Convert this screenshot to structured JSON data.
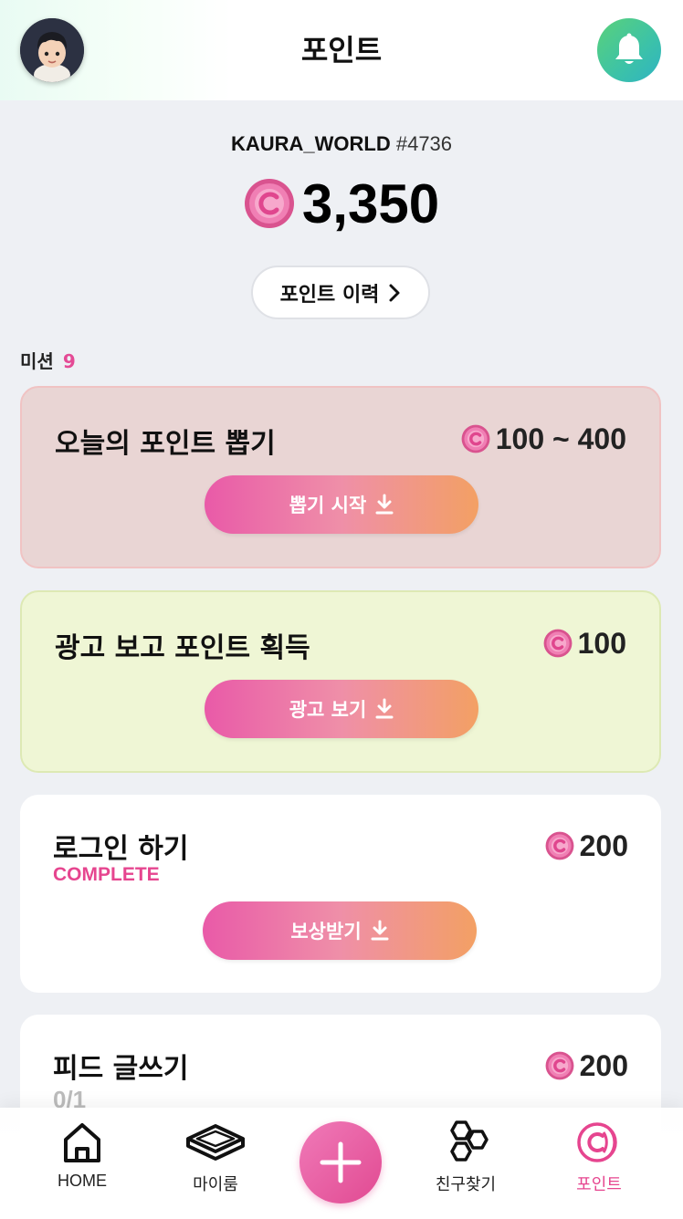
{
  "header": {
    "title": "포인트"
  },
  "summary": {
    "username": "KAURA_WORLD",
    "tag": "#4736",
    "balance": "3,350",
    "history_label": "포인트 이력"
  },
  "missions": {
    "label": "미션",
    "count": "9",
    "items": [
      {
        "title": "오늘의 포인트 뽑기",
        "reward": "100 ~ 400",
        "button": "뽑기 시작"
      },
      {
        "title": "광고 보고 포인트 획득",
        "reward": "100",
        "button": "광고 보기"
      },
      {
        "title": "로그인 하기",
        "reward": "200",
        "status": "COMPLETE",
        "button": "보상받기"
      },
      {
        "title": "피드 글쓰기",
        "reward": "200",
        "status": "0/1"
      }
    ]
  },
  "nav": {
    "items": [
      {
        "label": "HOME",
        "icon": "home-icon"
      },
      {
        "label": "마이룸",
        "icon": "room-icon"
      },
      {
        "label": "친구찾기",
        "icon": "hexagon-friends-icon"
      },
      {
        "label": "포인트",
        "icon": "point-coin-icon"
      }
    ],
    "active": "포인트"
  },
  "colors": {
    "accent": "#e6458f",
    "pink_card": "#e9d5d4",
    "green_card": "#eff6d5",
    "button_gradient_start": "#e95aa8",
    "button_gradient_end": "#f3a064",
    "bell_gradient": "#4cc995"
  }
}
